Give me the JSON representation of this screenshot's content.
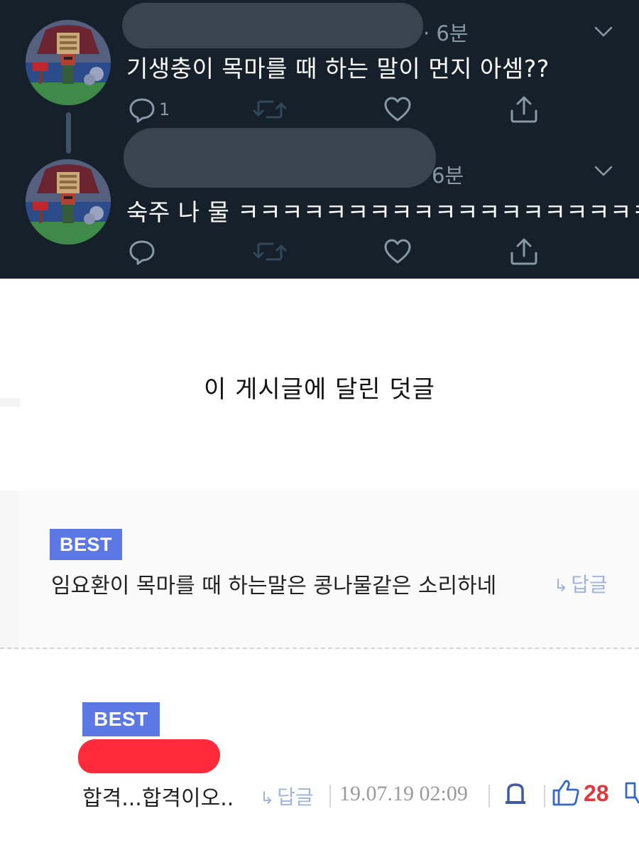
{
  "colors": {
    "twitter_bg": "#15202b",
    "twitter_text": "#ffffff",
    "twitter_muted": "#8899a6",
    "best_badge": "#5b78e4",
    "reply_link": "#9fb4de",
    "like_count": "#e0393e",
    "redaction": "#ff2a3c"
  },
  "tweets": [
    {
      "time": "· 6분",
      "text": "기생충이 목마를 때 하는 말이 먼지 아셈??",
      "reply_count": "1",
      "icons": [
        "reply-icon",
        "retweet-icon",
        "like-icon",
        "share-icon",
        "chevron-down-icon"
      ]
    },
    {
      "time": "6분",
      "text": "숙주 나 물 ㅋㅋㅋㅋㅋㅋㅋㅋㅋㅋㅋㅋㅋㅋㅋㅋㅋㅋㅋ",
      "reply_count": "",
      "icons": [
        "reply-icon",
        "retweet-icon",
        "like-icon",
        "share-icon",
        "chevron-down-icon"
      ]
    }
  ],
  "caption": "이 게시글에 달린 덧글",
  "comments": [
    {
      "badge": "BEST",
      "text": "임요환이 목마를 때 하는말은 콩나물같은 소리하네",
      "reply_arrow": "↳",
      "reply_label": "답글"
    },
    {
      "badge": "BEST",
      "text": "합격...합격이오..",
      "reply_arrow": "↳",
      "reply_label": "답글",
      "date": "19.07.19 02:09",
      "likes": "28",
      "icons": [
        "report-icon",
        "thumbs-up-icon",
        "thumbs-down-icon"
      ]
    }
  ]
}
